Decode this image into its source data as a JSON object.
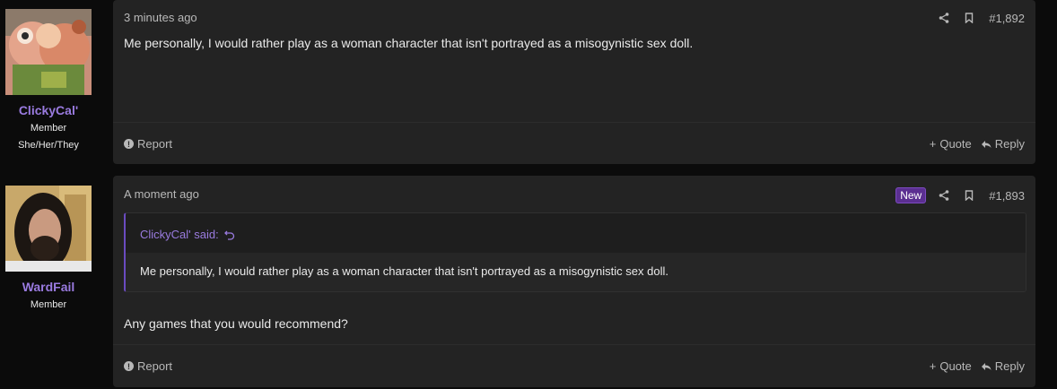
{
  "posts": [
    {
      "username": "ClickyCal'",
      "user_title": "Member",
      "pronouns": "She/Her/They",
      "timestamp": "3 minutes ago",
      "post_number": "#1,892",
      "body": "Me personally, I would rather play as a woman character that isn't portrayed as a misogynistic sex doll.",
      "report_label": "Report",
      "quote_label": "Quote",
      "reply_label": "Reply"
    },
    {
      "username": "WardFail",
      "user_title": "Member",
      "timestamp": "A moment ago",
      "badge": "New",
      "post_number": "#1,893",
      "quote": {
        "author_said": "ClickyCal' said:",
        "text": "Me personally, I would rather play as a woman character that isn't portrayed as a misogynistic sex doll."
      },
      "body": "Any games that you would recommend?",
      "report_label": "Report",
      "quote_label": "Quote",
      "reply_label": "Reply"
    }
  ],
  "colors": {
    "username": "#9a7be0",
    "badge_bg": "#5b2f91",
    "card_bg": "#232323"
  },
  "icons": [
    "share-icon",
    "bookmark-icon",
    "report-icon",
    "plus-icon",
    "reply-icon",
    "jump-to-quote-icon"
  ]
}
